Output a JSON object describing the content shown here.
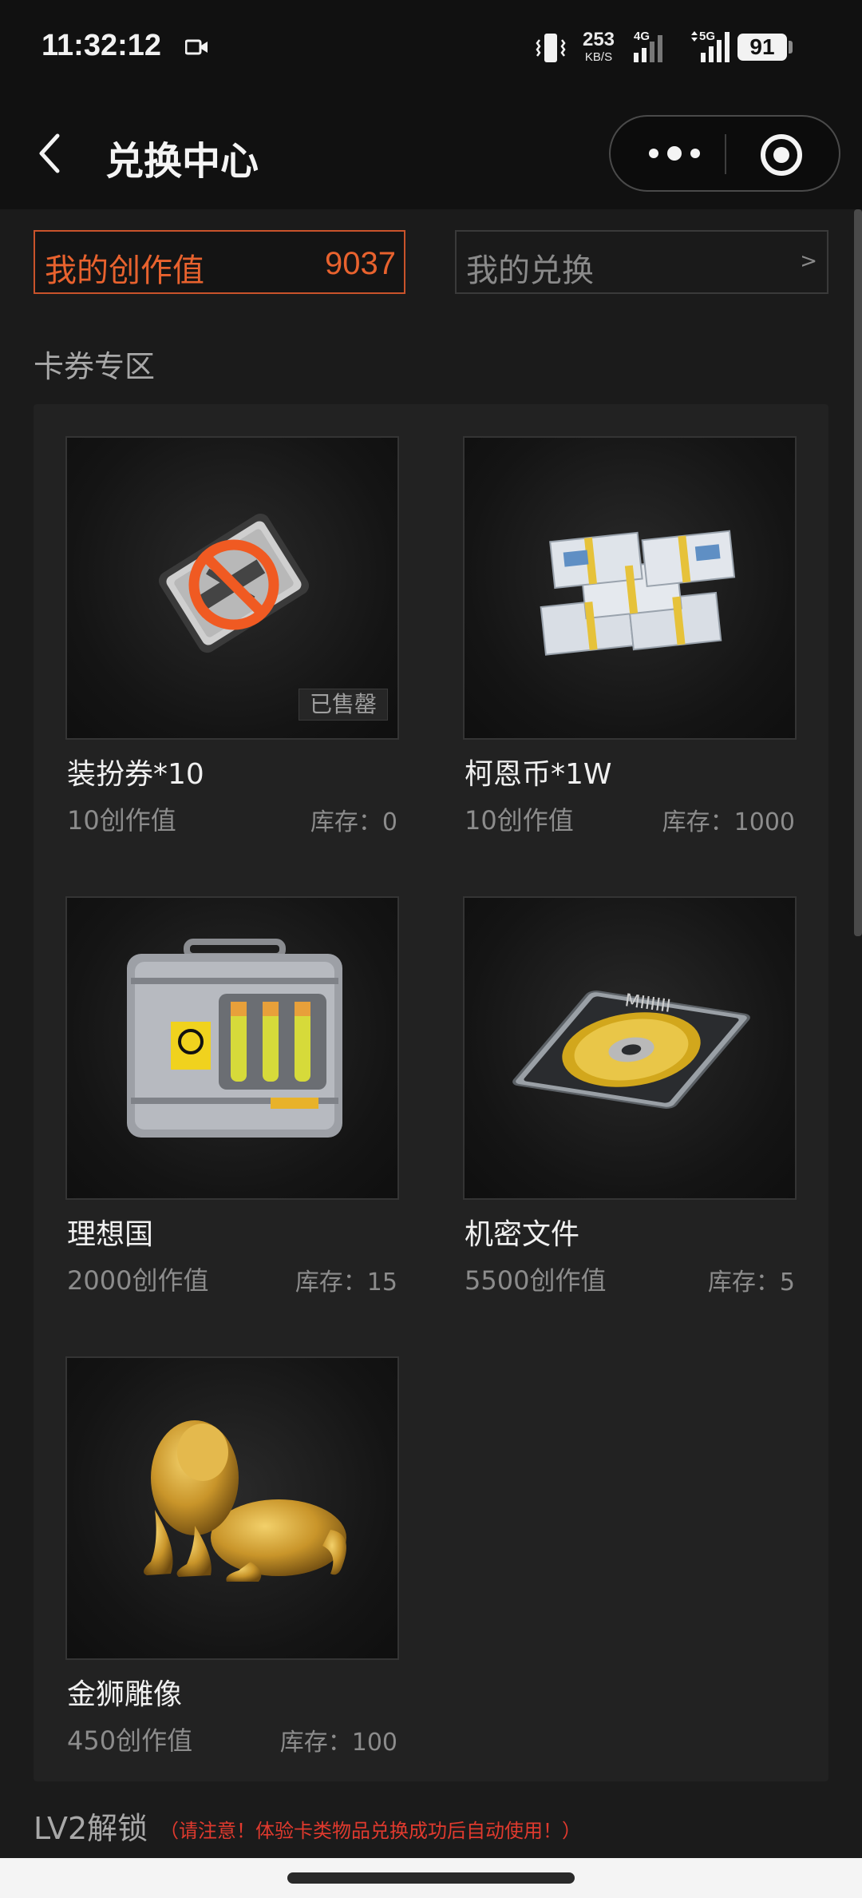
{
  "status_bar": {
    "time": "11:32:12",
    "net_speed_value": "253",
    "net_speed_unit": "KB/S",
    "signal_1_label": "4G",
    "signal_2_label": "5G",
    "battery": "91",
    "icons": [
      "video-camera-icon",
      "vibrate-icon",
      "signal-4g-icon",
      "signal-5g-icon",
      "battery-icon"
    ]
  },
  "nav": {
    "back_icon": "chevron-left-icon",
    "title": "兑换中心",
    "more_icon": "more-dots-icon",
    "close_icon": "target-close-icon"
  },
  "summary": {
    "credit_label": "我的创作值",
    "credit_value": "9037",
    "exchange_label": "我的兑换",
    "exchange_arrow": ">"
  },
  "section": {
    "title": "卡券专区",
    "items": [
      {
        "name": "装扮券*10",
        "price": "10创作值",
        "stock": "库存：0",
        "sold_out": "已售罄",
        "image": "costume-ticket-image"
      },
      {
        "name": "柯恩币*1W",
        "price": "10创作值",
        "stock": "库存：1000",
        "image": "banknote-stack-image"
      },
      {
        "name": "理想国",
        "price": "2000创作值",
        "stock": "库存：15",
        "image": "biohazard-case-image"
      },
      {
        "name": "机密文件",
        "price": "5500创作值",
        "stock": "库存：5",
        "image": "disc-file-image"
      },
      {
        "name": "金狮雕像",
        "price": "450创作值",
        "stock": "库存：100",
        "image": "gold-lion-image"
      }
    ]
  },
  "lv2": {
    "title": "LV2解锁",
    "note": "（请注意！体验卡类物品兑换成功后自动使用！）"
  },
  "colors": {
    "accent": "#e8622e",
    "warning": "#e03a2e",
    "background": "#1b1b1b",
    "panel": "#222222"
  }
}
